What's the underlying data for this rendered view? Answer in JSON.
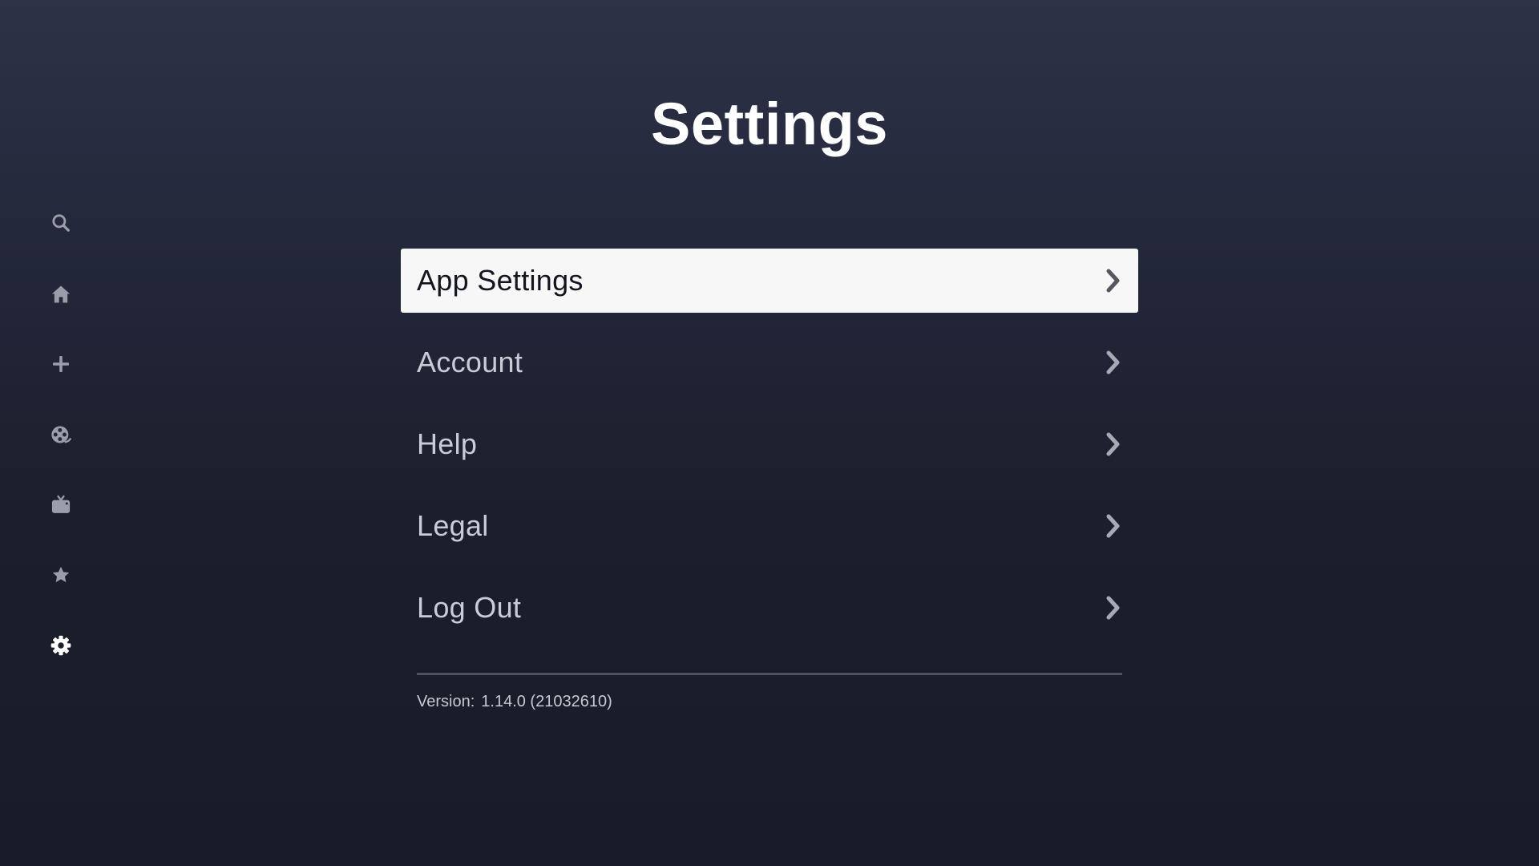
{
  "page": {
    "title": "Settings"
  },
  "sidebar": {
    "items": [
      {
        "icon": "search-icon",
        "active": false
      },
      {
        "icon": "home-icon",
        "active": false
      },
      {
        "icon": "plus-icon",
        "active": false
      },
      {
        "icon": "film-reel-icon",
        "active": false
      },
      {
        "icon": "tv-icon",
        "active": false
      },
      {
        "icon": "star-icon",
        "active": false
      },
      {
        "icon": "gear-icon",
        "active": true
      }
    ]
  },
  "menu": {
    "items": [
      {
        "label": "App Settings",
        "focused": true
      },
      {
        "label": "Account",
        "focused": false
      },
      {
        "label": "Help",
        "focused": false
      },
      {
        "label": "Legal",
        "focused": false
      },
      {
        "label": "Log Out",
        "focused": false
      }
    ]
  },
  "footer": {
    "version_label": "Version:",
    "version_value": "1.14.0 (21032610)"
  },
  "colors": {
    "inactive_icon": "#9b9eaa",
    "active_icon": "#ffffff",
    "focused_bg": "#f7f7f8",
    "focused_text": "#14161f",
    "menu_text": "#c9ccd6"
  }
}
